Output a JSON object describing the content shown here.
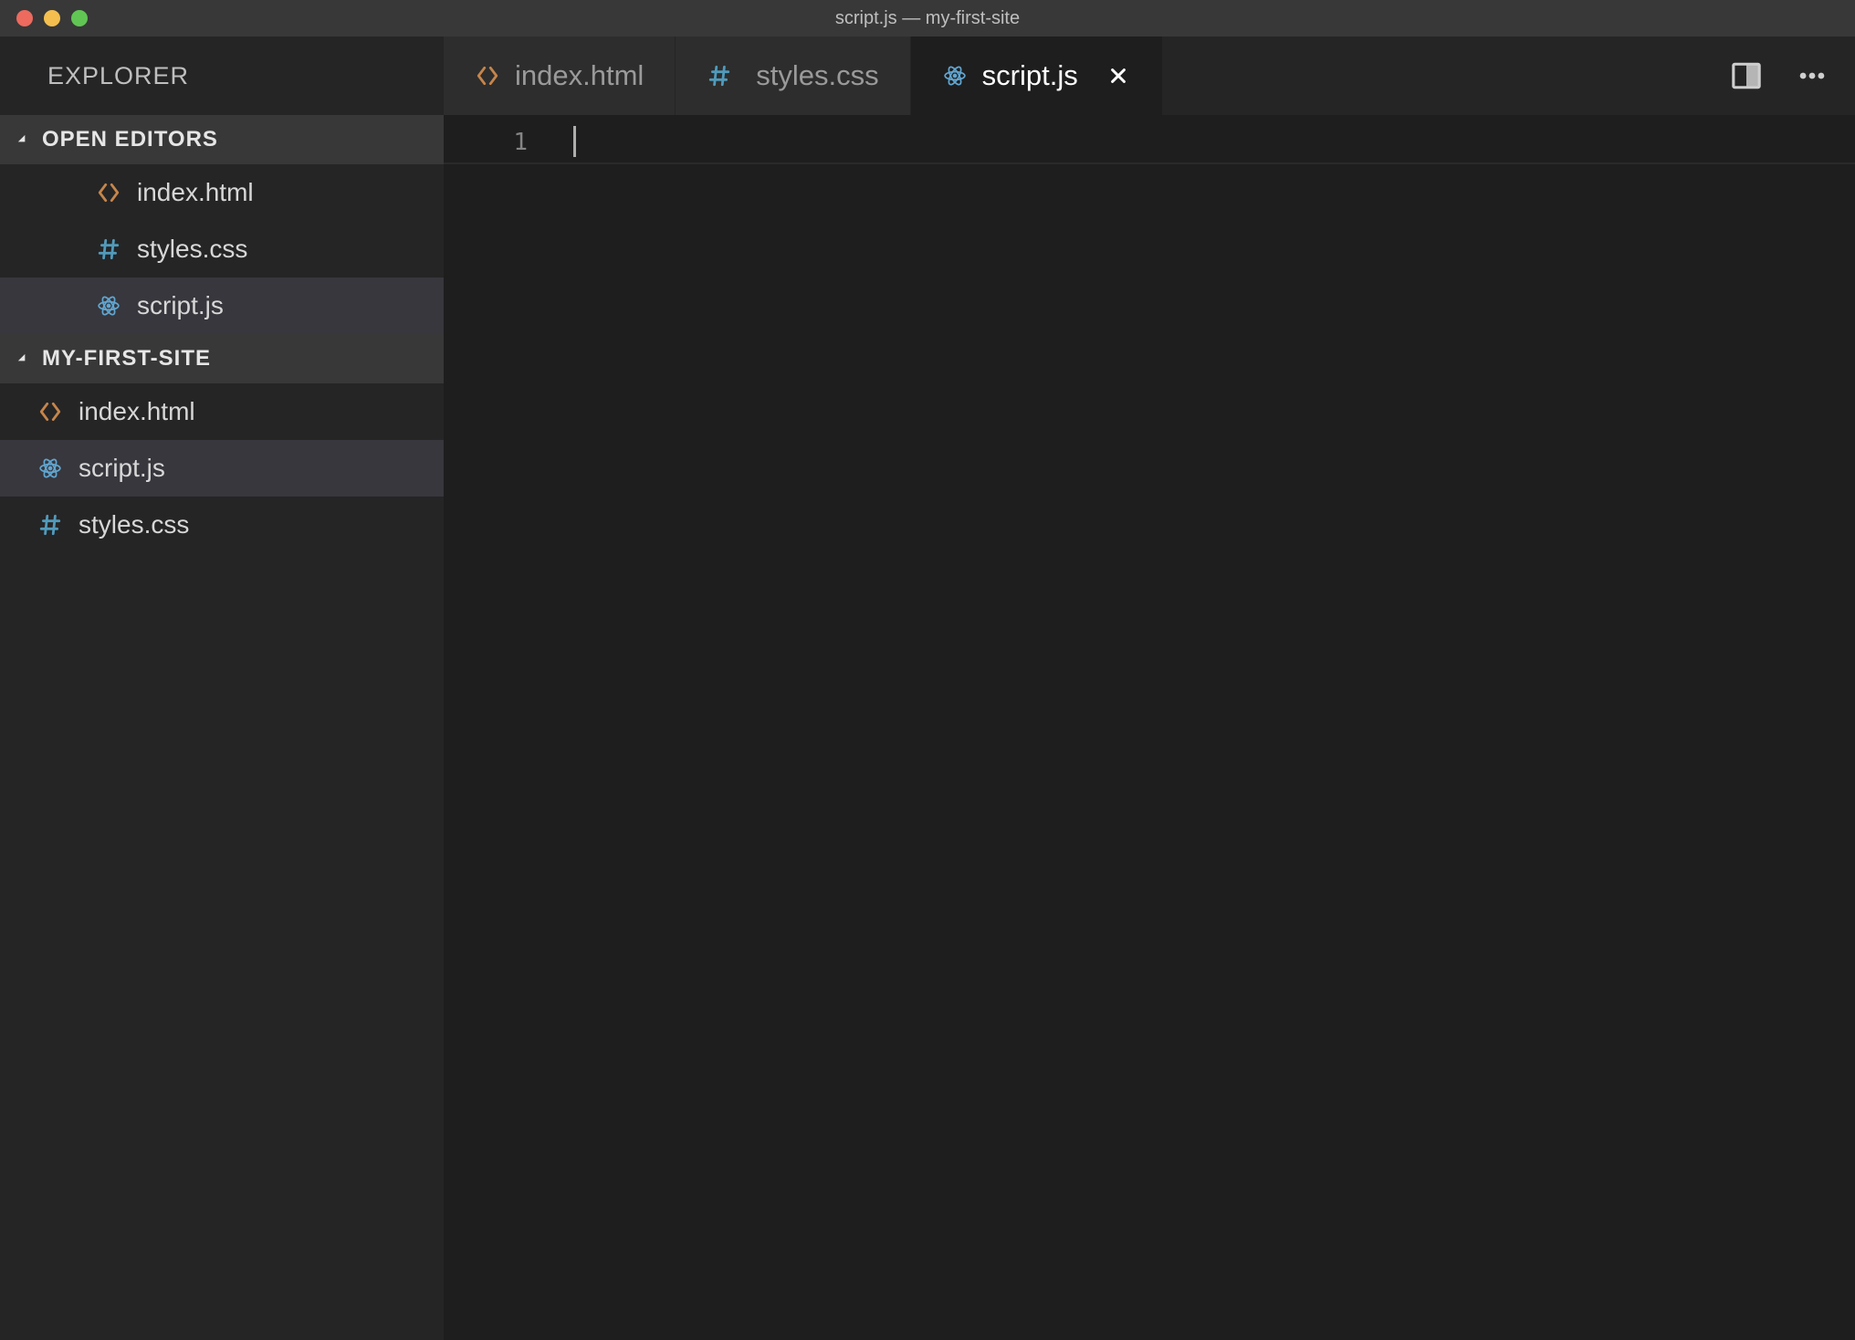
{
  "window": {
    "title": "script.js — my-first-site"
  },
  "sidebar": {
    "title": "EXPLORER",
    "sections": {
      "open_editors": {
        "label": "OPEN EDITORS",
        "items": [
          {
            "label": "index.html",
            "icon": "html-bracket-icon",
            "selected": false
          },
          {
            "label": "styles.css",
            "icon": "hash-icon",
            "selected": false
          },
          {
            "label": "script.js",
            "icon": "react-atom-icon",
            "selected": true
          }
        ]
      },
      "folder": {
        "label": "MY-FIRST-SITE",
        "items": [
          {
            "label": "index.html",
            "icon": "html-bracket-icon",
            "selected": false
          },
          {
            "label": "script.js",
            "icon": "react-atom-icon",
            "selected": true
          },
          {
            "label": "styles.css",
            "icon": "hash-icon",
            "selected": false
          }
        ]
      }
    }
  },
  "tabs": {
    "items": [
      {
        "label": "index.html",
        "icon": "html-bracket-icon",
        "active": false,
        "closeable": false
      },
      {
        "label": "styles.css",
        "icon": "hash-icon",
        "active": false,
        "closeable": false
      },
      {
        "label": "script.js",
        "icon": "react-atom-icon",
        "active": true,
        "closeable": true
      }
    ]
  },
  "editor": {
    "line_numbers": [
      "1"
    ],
    "content": ""
  },
  "colors": {
    "html_icon": "#c5854b",
    "css_icon": "#519aba",
    "js_icon": "#61a6d1"
  }
}
